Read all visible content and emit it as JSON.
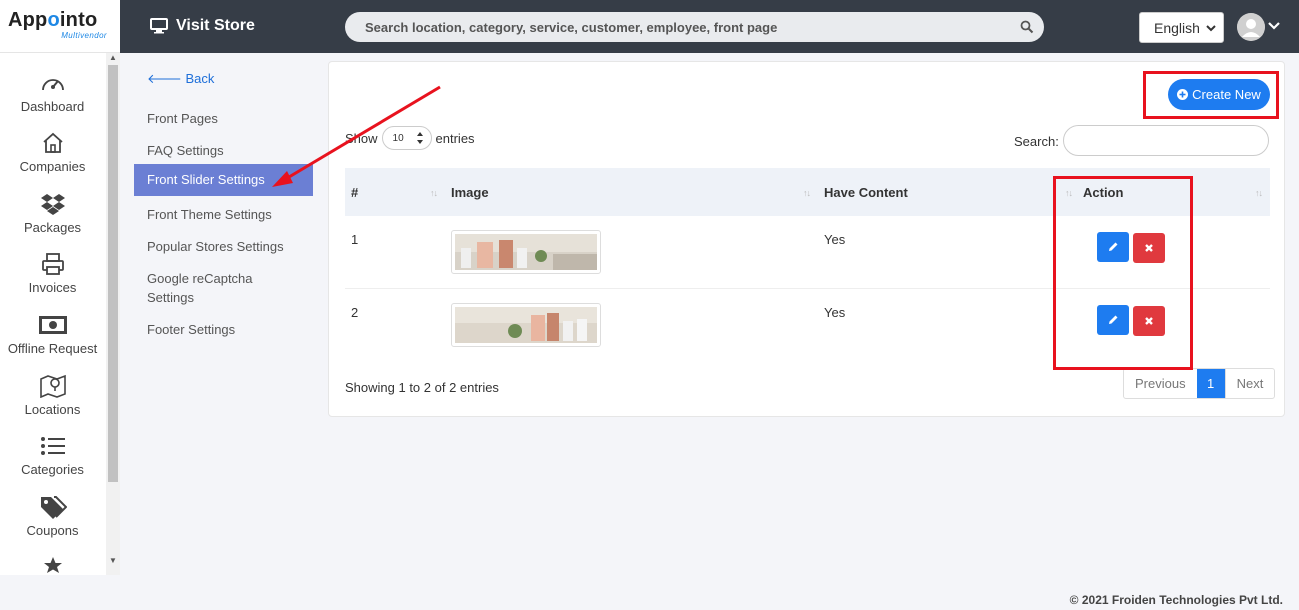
{
  "brand": {
    "name_prefix": "App",
    "name_accent": "o",
    "name_suffix": "into",
    "subtitle": "Multivendor"
  },
  "topbar": {
    "visit_store": "Visit Store",
    "search_placeholder": "Search location, category, service, customer, employee, front page",
    "language": "English"
  },
  "sidebar": {
    "items": [
      {
        "label": "Dashboard",
        "icon": "gauge-icon"
      },
      {
        "label": "Companies",
        "icon": "home-icon"
      },
      {
        "label": "Packages",
        "icon": "dropbox-icon"
      },
      {
        "label": "Invoices",
        "icon": "printer-icon"
      },
      {
        "label": "Offline Request",
        "icon": "money-icon"
      },
      {
        "label": "Locations",
        "icon": "map-icon"
      },
      {
        "label": "Categories",
        "icon": "list-icon"
      },
      {
        "label": "Coupons",
        "icon": "tags-icon"
      },
      {
        "label": "",
        "icon": "star-icon"
      }
    ]
  },
  "submenu": {
    "back": "Back",
    "items": [
      {
        "label": "Front Pages"
      },
      {
        "label": "FAQ Settings"
      },
      {
        "label": "Front Slider Settings",
        "active": true
      },
      {
        "label": "Front Theme Settings"
      },
      {
        "label": "Popular Stores Settings"
      },
      {
        "label": "Google reCaptcha Settings"
      },
      {
        "label": "Footer Settings"
      }
    ]
  },
  "card": {
    "create_new": "Create New",
    "show_label": "Show",
    "entries_value": "10",
    "entries_label": "entries",
    "search_label": "Search:",
    "columns": [
      "#",
      "Image",
      "Have Content",
      "Action"
    ],
    "rows": [
      {
        "num": "1",
        "have_content": "Yes"
      },
      {
        "num": "2",
        "have_content": "Yes"
      }
    ],
    "showing": "Showing 1 to 2 of 2 entries",
    "pager": {
      "prev": "Previous",
      "current": "1",
      "next": "Next"
    }
  },
  "footer": "© 2021 Froiden Technologies Pvt Ltd.",
  "colors": {
    "primary": "#1e7cf0",
    "danger": "#e0393e",
    "annotation": "#e8121e",
    "topbar": "#363d47",
    "active_menu": "#6b7fd4"
  }
}
